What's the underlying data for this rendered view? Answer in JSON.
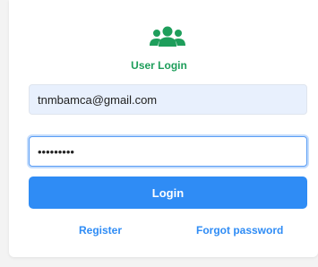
{
  "login": {
    "icon": "users-icon",
    "title": "User Login",
    "email_value": "tnmbamca@gmail.com",
    "password_value": "•••••••••",
    "login_label": "Login",
    "register_label": "Register",
    "forgot_label": "Forgot password"
  },
  "colors": {
    "accent": "#2f8cf5",
    "title_green": "#1e9e5b",
    "email_bg": "#e8f0fd",
    "focus_border": "#5a9df5"
  }
}
